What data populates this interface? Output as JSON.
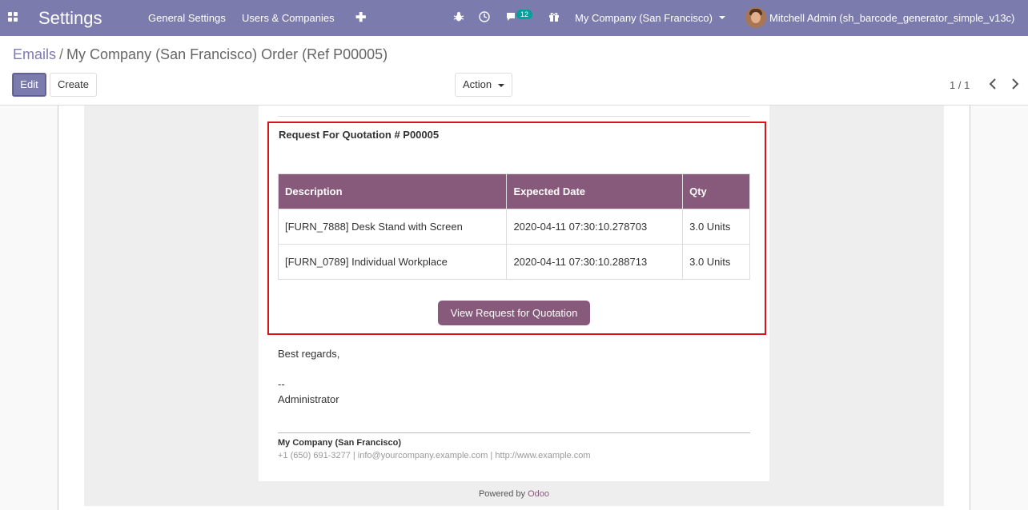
{
  "navbar": {
    "app_title": "Settings",
    "menu": [
      "General Settings",
      "Users & Companies"
    ],
    "new_icon": "plus-icon",
    "icons": [
      "bug-icon",
      "clock-icon",
      "chat-icon",
      "gift-icon"
    ],
    "messages_count": "12",
    "company": "My Company (San Francisco)",
    "user": "Mitchell Admin (sh_barcode_generator_simple_v13c)",
    "color": "#7c7bad"
  },
  "breadcrumb": {
    "parent": "Emails",
    "separator": "/",
    "current": "My Company (San Francisco) Order (Ref P00005)"
  },
  "toolbar": {
    "edit_label": "Edit",
    "create_label": "Create",
    "action_label": "Action"
  },
  "pager": {
    "value": "1 / 1"
  },
  "email": {
    "rfq_title": "Request For Quotation # P00005",
    "table": {
      "headers": [
        "Description",
        "Expected Date",
        "Qty"
      ],
      "rows": [
        [
          "[FURN_7888] Desk Stand with Screen",
          "2020-04-11 07:30:10.278703",
          "3.0 Units"
        ],
        [
          "[FURN_0789] Individual Workplace",
          "2020-04-11 07:30:10.288713",
          "3.0 Units"
        ]
      ]
    },
    "view_button": "View Request for Quotation",
    "regards": "Best regards,",
    "signature_dash": "--",
    "signature_name": "Administrator",
    "footer_company": "My Company (San Francisco)",
    "footer_contact": "+1 (650) 691-3277 | info@yourcompany.example.com | http://www.example.com",
    "powered_by": "Powered by",
    "powered_brand": "Odoo",
    "accent_color": "#875a7b",
    "highlight_color": "#d9131b"
  }
}
